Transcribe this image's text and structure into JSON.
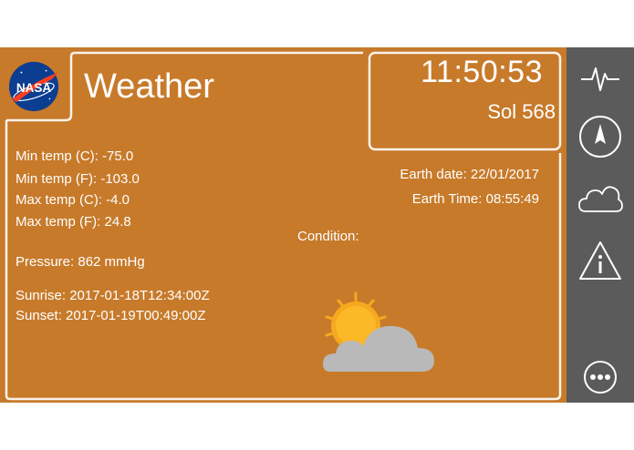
{
  "header": {
    "agency_logo_text": "NASA",
    "title": "Weather",
    "clock": "11:50:53",
    "sol": "Sol 568"
  },
  "stats": {
    "min_temp_c": "Min temp (C): -75.0",
    "min_temp_f": "Min temp (F): -103.0",
    "max_temp_c": "Max temp (C): -4.0",
    "max_temp_f": "Max temp (F): 24.8",
    "pressure": "Pressure: 862 mmHg",
    "sunrise": "Sunrise: 2017-01-18T12:34:00Z",
    "sunset": "Sunset: 2017-01-19T00:49:00Z"
  },
  "earth": {
    "date": "Earth date: 22/01/2017",
    "time": "Earth Time: 08:55:49"
  },
  "condition": {
    "label": "Condition:",
    "icon": "partly-cloudy-icon"
  },
  "sidebar": {
    "items": [
      {
        "icon": "pulse-icon"
      },
      {
        "icon": "compass-icon"
      },
      {
        "icon": "cloud-icon"
      },
      {
        "icon": "info-icon"
      },
      {
        "icon": "more-icon"
      }
    ]
  },
  "colors": {
    "panel": "#c77a2a",
    "sidebar": "#5b5b5b",
    "text": "#ffffff",
    "nasa_blue": "#0b3d91",
    "nasa_red": "#fc3d21",
    "sun": "#f6a91e",
    "cloud": "#b9b9b9"
  }
}
